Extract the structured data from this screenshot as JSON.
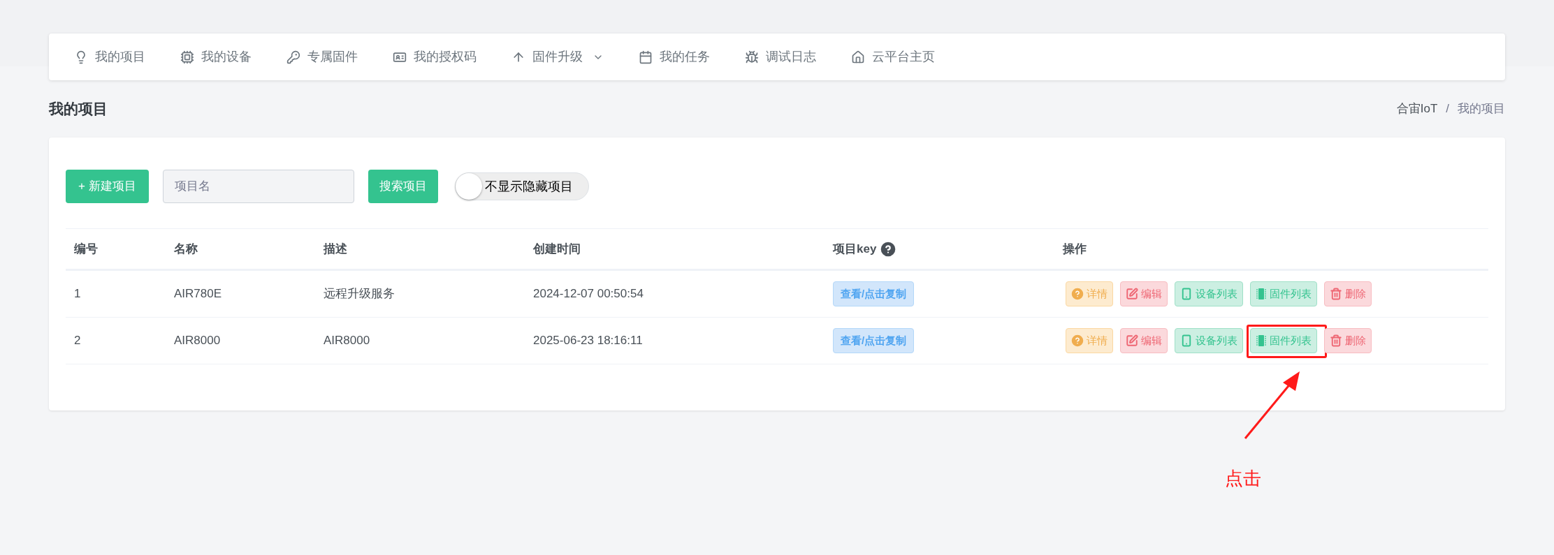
{
  "nav": [
    {
      "label": "我的项目",
      "kind": "bulb",
      "dropdown": false
    },
    {
      "label": "我的设备",
      "kind": "chip",
      "dropdown": false
    },
    {
      "label": "专属固件",
      "kind": "key",
      "dropdown": false
    },
    {
      "label": "我的授权码",
      "kind": "card",
      "dropdown": false
    },
    {
      "label": "固件升级",
      "kind": "up",
      "dropdown": true
    },
    {
      "label": "我的任务",
      "kind": "calendar",
      "dropdown": false
    },
    {
      "label": "调试日志",
      "kind": "bug",
      "dropdown": false
    },
    {
      "label": "云平台主页",
      "kind": "home",
      "dropdown": false
    }
  ],
  "page_title": "我的项目",
  "breadcrumb": [
    "合宙IoT",
    "/",
    "我的项目"
  ],
  "toolbar": {
    "new_button": "+ 新建项目",
    "search": {
      "placeholder": "项目名"
    },
    "search_button": "搜索项目",
    "toggle": {
      "label": "不显示隐藏项目",
      "on": false
    }
  },
  "table": {
    "columns": [
      "编号",
      "名称",
      "描述",
      "创建时间",
      "项目key",
      "操作"
    ],
    "rows": [
      {
        "cells": [
          "1",
          "AIR780E",
          "远程升级服务",
          "2024-12-07 00:50:54"
        ],
        "key_button": "查看/点击复制",
        "actions": [
          {
            "kind": "detail",
            "label": "详情",
            "highlighted": false
          },
          {
            "kind": "edit",
            "label": "编辑",
            "highlighted": false
          },
          {
            "kind": "devices",
            "label": "设备列表",
            "highlighted": false
          },
          {
            "kind": "firmware",
            "label": "固件列表",
            "highlighted": false
          },
          {
            "kind": "delete",
            "label": "删除",
            "highlighted": false
          }
        ]
      },
      {
        "cells": [
          "2",
          "AIR8000",
          "AIR8000",
          "2025-06-23 18:16:11"
        ],
        "key_button": "查看/点击复制",
        "actions": [
          {
            "kind": "detail",
            "label": "详情",
            "highlighted": false
          },
          {
            "kind": "edit",
            "label": "编辑",
            "highlighted": false
          },
          {
            "kind": "devices",
            "label": "设备列表",
            "highlighted": false
          },
          {
            "kind": "firmware",
            "label": "固件列表",
            "highlighted": true
          },
          {
            "kind": "delete",
            "label": "删除",
            "highlighted": false
          }
        ]
      }
    ]
  },
  "annotation": {
    "text": "点击"
  }
}
